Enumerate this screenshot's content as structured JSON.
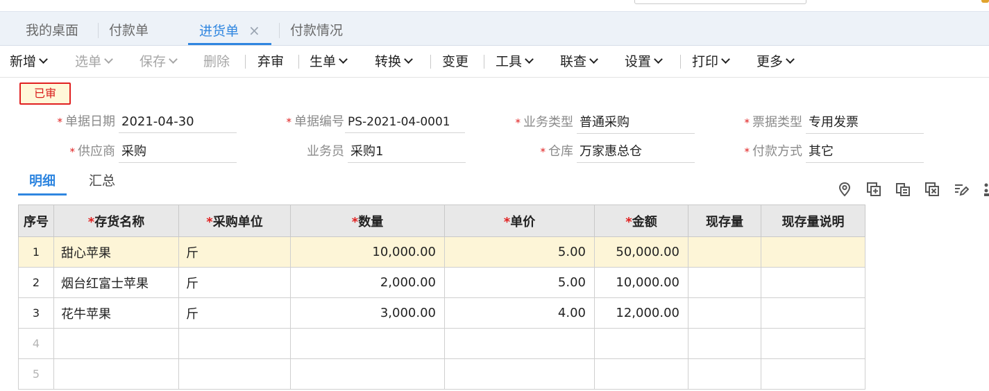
{
  "tabs": [
    {
      "label": "我的桌面"
    },
    {
      "label": "付款单"
    },
    {
      "label": "进货单",
      "close": "×"
    },
    {
      "label": "付款情况"
    }
  ],
  "toolbar": {
    "add": "新增",
    "select": "选单",
    "save": "保存",
    "delete": "删除",
    "abandon": "弃审",
    "generate": "生单",
    "convert": "转换",
    "change": "变更",
    "tools": "工具",
    "linked": "联查",
    "settings": "设置",
    "print": "打印",
    "more": "更多"
  },
  "status": "已审",
  "form": {
    "date": {
      "label": "单据日期",
      "value": "2021-04-30"
    },
    "number": {
      "label": "单据编号",
      "value": "PS-2021-04-0001"
    },
    "biztype": {
      "label": "业务类型",
      "value": "普通采购"
    },
    "invoicetype": {
      "label": "票据类型",
      "value": "专用发票"
    },
    "supplier": {
      "label": "供应商",
      "value": "采购"
    },
    "clerk": {
      "label": "业务员",
      "value": "采购1"
    },
    "warehouse": {
      "label": "仓库",
      "value": "万家惠总仓"
    },
    "payment": {
      "label": "付款方式",
      "value": "其它"
    }
  },
  "subtabs": {
    "detail": "明细",
    "summary": "汇总"
  },
  "grid": {
    "headers": [
      "序号",
      "存货名称",
      "采购单位",
      "数量",
      "单价",
      "金额",
      "现存量",
      "现存量说明"
    ],
    "rows": [
      {
        "idx": "1",
        "name": "甜心苹果",
        "unit": "斤",
        "qty": "10,000.00",
        "price": "5.00",
        "amount": "50,000.00",
        "stock": "",
        "stocknote": ""
      },
      {
        "idx": "2",
        "name": "烟台红富士苹果",
        "unit": "斤",
        "qty": "2,000.00",
        "price": "5.00",
        "amount": "10,000.00",
        "stock": "",
        "stocknote": ""
      },
      {
        "idx": "3",
        "name": "花牛苹果",
        "unit": "斤",
        "qty": "3,000.00",
        "price": "4.00",
        "amount": "12,000.00",
        "stock": "",
        "stocknote": ""
      },
      {
        "idx": "4"
      },
      {
        "idx": "5"
      }
    ]
  },
  "colors": {
    "accent": "#2f86e0",
    "required": "#e02020",
    "selected_row": "#fdf5d7"
  },
  "icons": [
    "location-pin-icon",
    "add-row-icon",
    "copy-row-icon",
    "delete-row-icon",
    "batch-edit-icon",
    "more-icon"
  ]
}
